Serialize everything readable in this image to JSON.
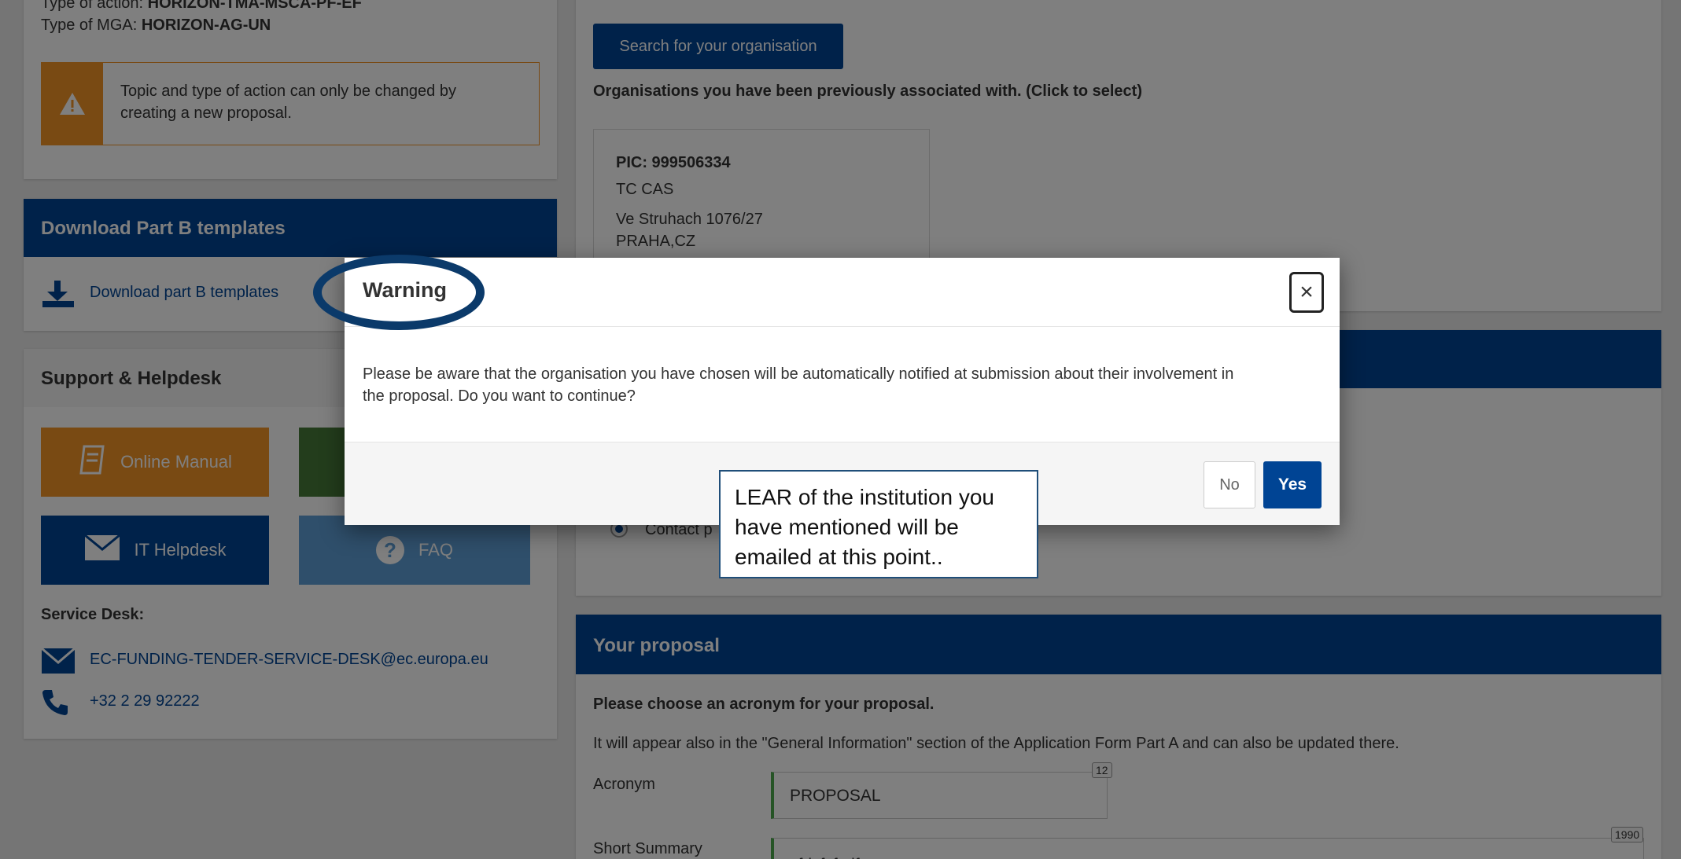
{
  "left": {
    "type_action_label": "Type of action:",
    "type_action_value": "HORIZON-TMA-MSCA-PF-EF",
    "type_mga_label": "Type of MGA:",
    "type_mga_value": "HORIZON-AG-UN",
    "warning_note": "Topic and type of action can only be changed by creating a new proposal.",
    "download_title": "Download Part B templates",
    "download_link": "Download part B templates",
    "support_title": "Support & Helpdesk",
    "online_manual": "Online Manual",
    "it_helpdesk": "IT Helpdesk",
    "faq": "FAQ",
    "service_desk_label": "Service Desk:",
    "service_email": "EC-FUNDING-TENDER-SERVICE-DESK@ec.europa.eu",
    "service_phone": "+32 2 29 92222"
  },
  "right": {
    "search_button": "Search for your organisation",
    "orgs_heading": "Organisations you have been previously associated with. (Click to select)",
    "org": {
      "pic": "PIC: 999506334",
      "name": "TC CAS",
      "address1": "Ve Struhach 1076/27",
      "address2": "PRAHA,CZ"
    },
    "contact_partial": "Contact p",
    "proposal_title": "Your proposal",
    "acronym_heading": "Please choose an acronym for your proposal.",
    "acronym_note": "It will appear also in the \"General Information\" section of the Application Form Part A and can also be updated there.",
    "acronym_label": "Acronym",
    "acronym_value": "PROPOSAL",
    "acronym_counter": "12",
    "summary_label": "Short Summary",
    "summary_value": "sfdsfsfsdf",
    "summary_counter": "1990"
  },
  "modal": {
    "title": "Warning",
    "close_symbol": "×",
    "body": "Please be aware that the organisation you have chosen will be automatically notified at submission about their involvement in the proposal. Do you want to continue?",
    "no_label": "No",
    "yes_label": "Yes"
  },
  "annotation": {
    "callout_text": "LEAR of the institution you have mentioned will be emailed at this point.."
  },
  "colors": {
    "brand_blue": "#004494",
    "manual_orange": "#f29527",
    "faq_blue": "#5e9fd6",
    "green_tile": "#467a39",
    "annotation_navy": "#0b3a6a"
  }
}
